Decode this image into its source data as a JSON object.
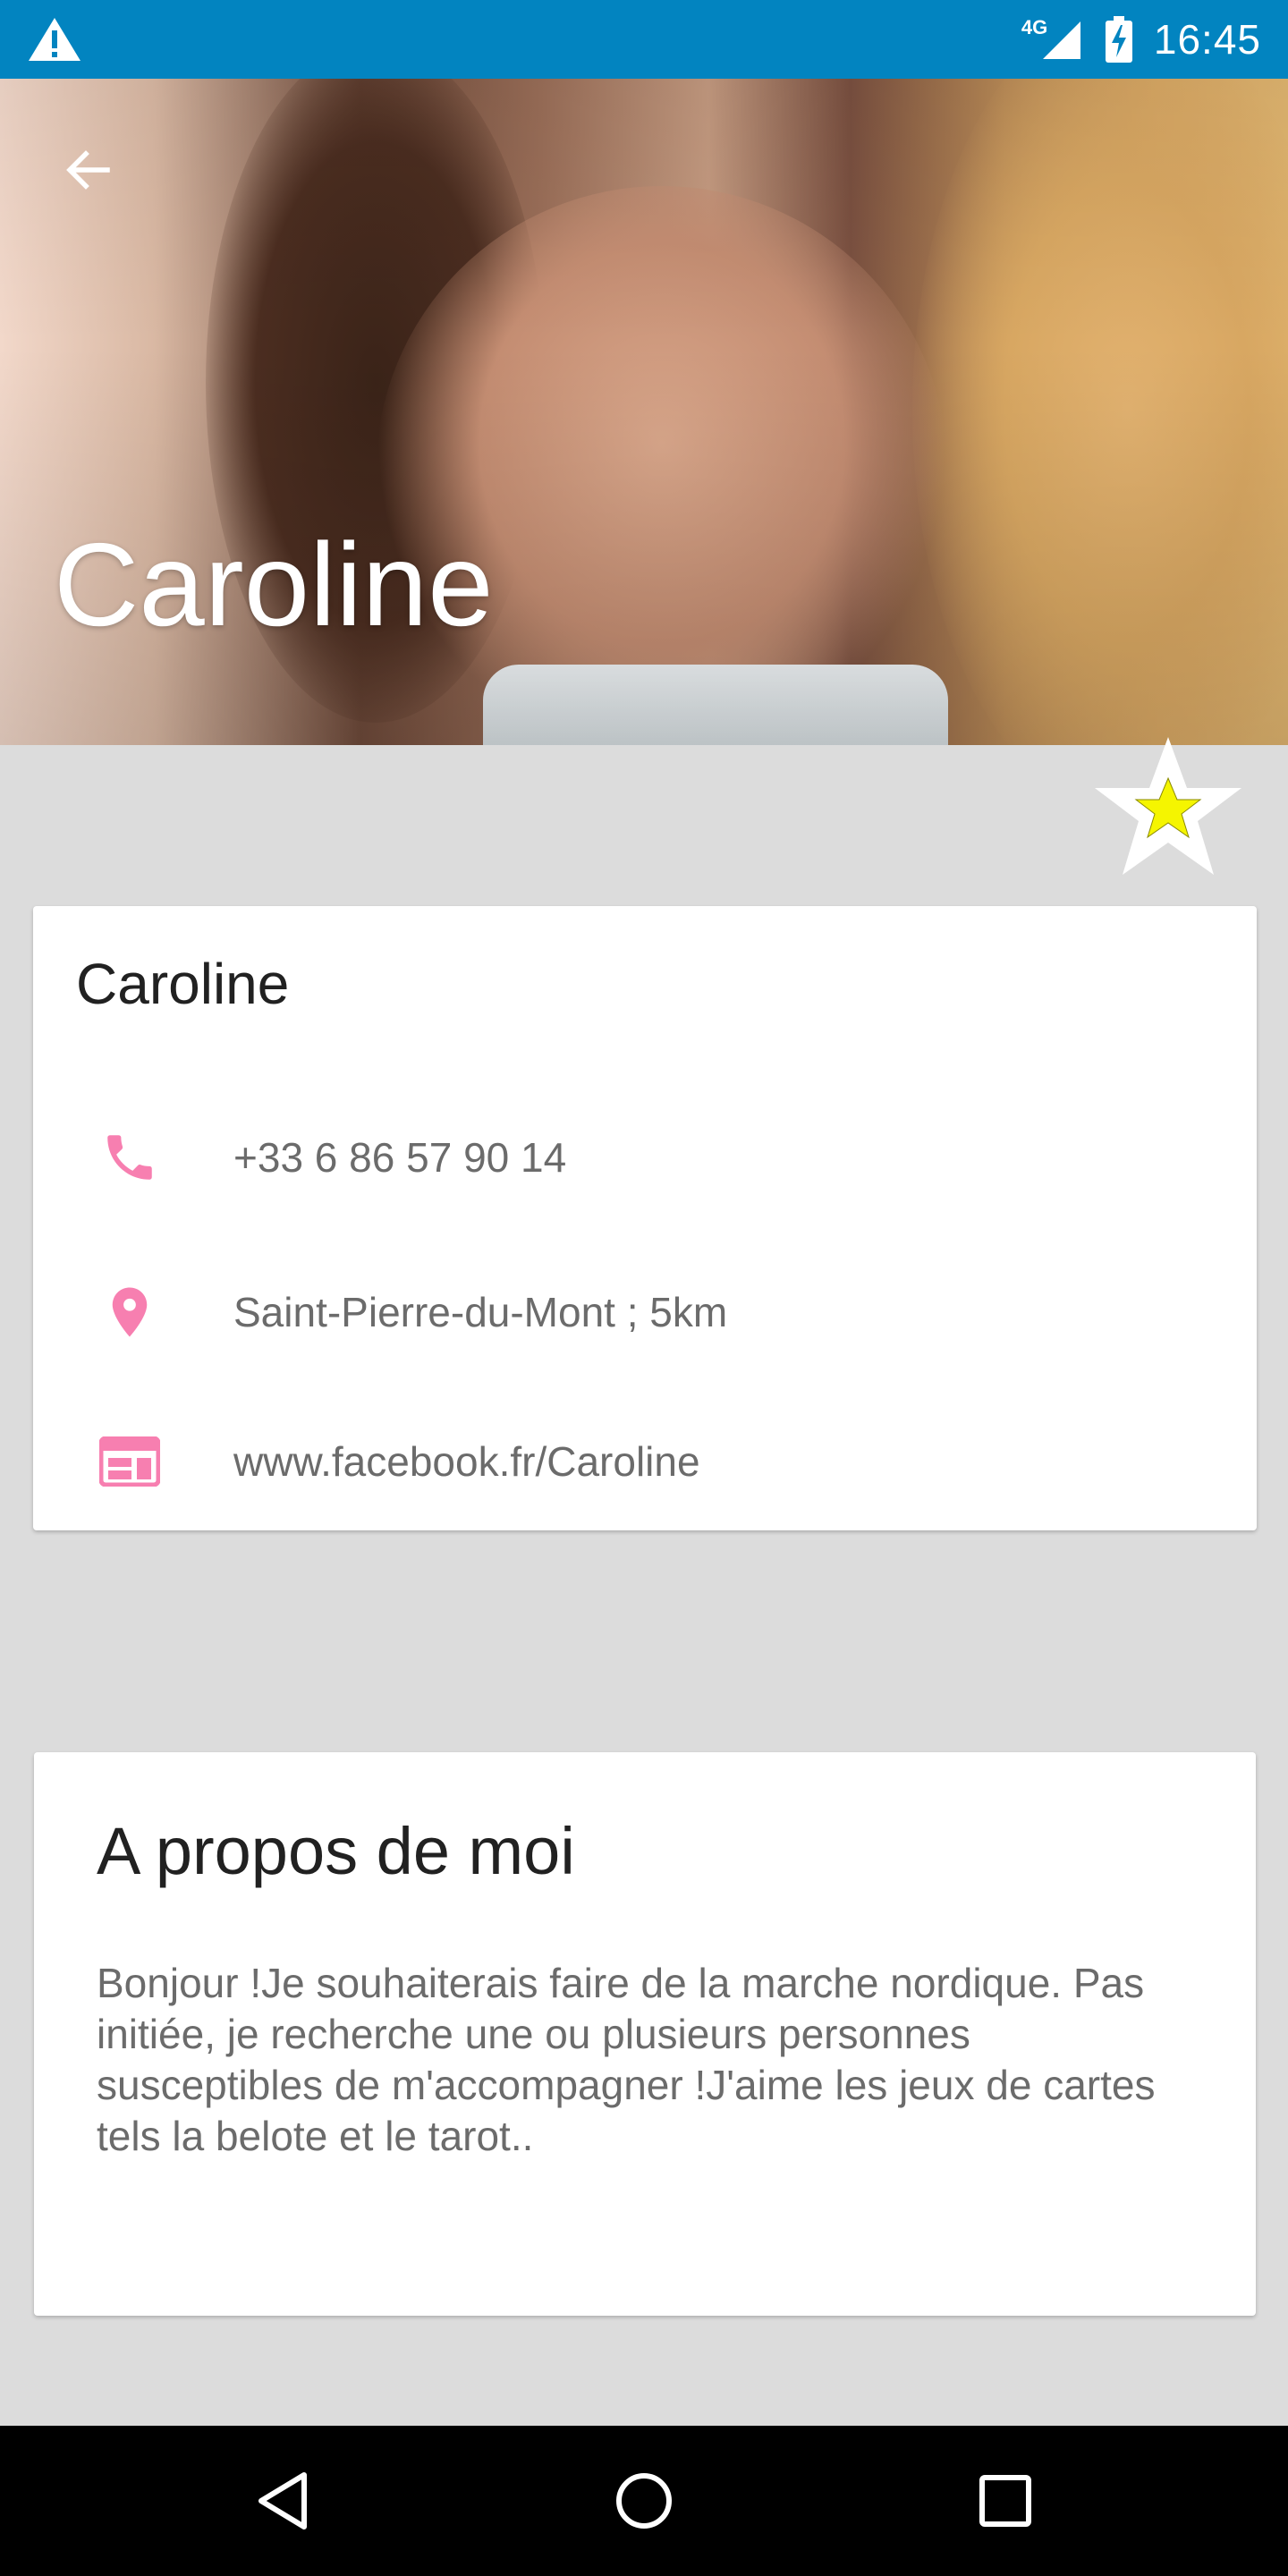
{
  "status_bar": {
    "network": "4G",
    "time": "16:45",
    "icons": [
      "warning-icon",
      "signal-icon",
      "battery-charging-icon"
    ]
  },
  "hero": {
    "title": "Caroline",
    "back_icon": "arrow-back-icon"
  },
  "favorite": {
    "icon": "star-icon",
    "fill_color": "#ffff00"
  },
  "contact": {
    "name": "Caroline",
    "rows": [
      {
        "icon": "phone-icon",
        "text": "+33 6 86 57 90 14"
      },
      {
        "icon": "location-pin-icon",
        "text": "Saint-Pierre-du-Mont ; 5km"
      },
      {
        "icon": "web-icon",
        "text": "www.facebook.fr/Caroline"
      }
    ]
  },
  "about": {
    "title": "A propos de moi",
    "body": "Bonjour !Je souhaiterais faire de la marche nordique. Pas initiée, je recherche une ou plusieurs personnes susceptibles de m'accompagner !J'aime les jeux de cartes tels la belote et le tarot.."
  },
  "nav": {
    "back_icon": "nav-back-icon",
    "home_icon": "nav-home-icon",
    "recents_icon": "nav-recents-icon"
  },
  "colors": {
    "status_bar": "#0284c0",
    "accent_pink": "#f77fb0",
    "background": "#dcdcdc"
  }
}
